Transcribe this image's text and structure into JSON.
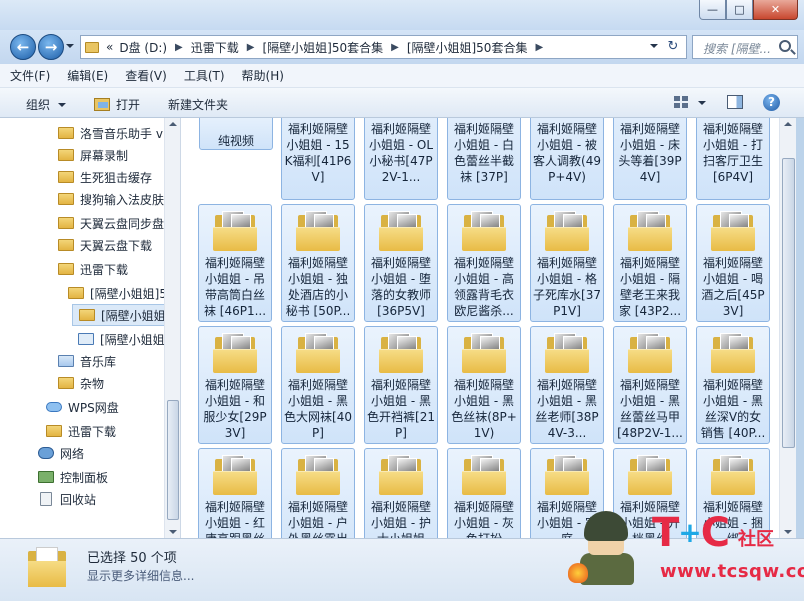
{
  "window": {
    "minimize": "—",
    "maximize": "□",
    "close": "✕"
  },
  "nav": {
    "back": "←",
    "forward": "→"
  },
  "address": {
    "prefix": "«",
    "crumbs": [
      "D盘 (D:)",
      "迅雷下载",
      "[隔壁小姐姐]50套合集",
      "[隔壁小姐姐]50套合集"
    ],
    "refresh": "↻"
  },
  "search": {
    "placeholder": "搜索 [隔壁..."
  },
  "menu": [
    "文件(F)",
    "编辑(E)",
    "查看(V)",
    "工具(T)",
    "帮助(H)"
  ],
  "toolbar": {
    "organize": "组织",
    "open": "打开",
    "new_folder": "新建文件夹",
    "help": "?"
  },
  "sidebar": {
    "items": [
      {
        "label": "洛雪音乐助手 v",
        "icon": "folder-icon"
      },
      {
        "label": "屏幕录制",
        "icon": "folder-icon"
      },
      {
        "label": "生死狙击缓存",
        "icon": "folder-icon"
      },
      {
        "label": "搜狗输入法皮肤",
        "icon": "folder-icon"
      },
      {
        "label": "天翼云盘同步盘",
        "icon": "folder-icon"
      },
      {
        "label": "天翼云盘下载",
        "icon": "folder-icon"
      },
      {
        "label": "迅雷下载",
        "icon": "folder-icon"
      },
      {
        "label": "[隔壁小姐姐]5",
        "icon": "folder-icon"
      },
      {
        "label": "[隔壁小姐姐",
        "icon": "folder-icon"
      },
      {
        "label": "[隔壁小姐姐]",
        "icon": "zip-icon"
      },
      {
        "label": "音乐库",
        "icon": "music-library-icon"
      },
      {
        "label": "杂物",
        "icon": "folder-icon"
      },
      {
        "label": "WPS网盘",
        "icon": "cloud-icon"
      },
      {
        "label": "迅雷下载",
        "icon": "folder-icon"
      },
      {
        "label": "网络",
        "icon": "network-icon"
      },
      {
        "label": "控制面板",
        "icon": "control-panel-icon"
      },
      {
        "label": "回收站",
        "icon": "recycle-bin-icon"
      }
    ]
  },
  "folders": {
    "row0": [
      {
        "label": "纯视频"
      },
      {
        "label": "福利姬隔壁小姐姐 - 15K福利[41P6V]"
      },
      {
        "label": "福利姬隔壁小姐姐 - OL小秘书[47P2V-1..."
      },
      {
        "label": "福利姬隔壁小姐姐 - 白色蕾丝半截袜 [37P]"
      },
      {
        "label": "福利姬隔壁小姐姐 - 被客人调教(49P+4V)"
      },
      {
        "label": "福利姬隔壁小姐姐 - 床头等着[39P4V]"
      },
      {
        "label": "福利姬隔壁小姐姐 - 打扫客厅卫生[6P4V]"
      }
    ],
    "row1": [
      {
        "label": "福利姬隔壁小姐姐 - 吊带高筒白丝袜 [46P1..."
      },
      {
        "label": "福利姬隔壁小姐姐 - 独处酒店的小秘书 [50P..."
      },
      {
        "label": "福利姬隔壁小姐姐 - 堕落的女教师[36P5V]"
      },
      {
        "label": "福利姬隔壁小姐姐 - 高领露背毛衣欧尼酱杀..."
      },
      {
        "label": "福利姬隔壁小姐姐 - 格子死库水[37P1V]"
      },
      {
        "label": "福利姬隔壁小姐姐 - 隔壁老王来我家 [43P2..."
      },
      {
        "label": "福利姬隔壁小姐姐 - 喝酒之后[45P3V]"
      }
    ],
    "row2": [
      {
        "label": "福利姬隔壁小姐姐 - 和服少女[29P3V]"
      },
      {
        "label": "福利姬隔壁小姐姐 - 黑色大网袜[40P]"
      },
      {
        "label": "福利姬隔壁小姐姐 - 黑色开裆裤[21P]"
      },
      {
        "label": "福利姬隔壁小姐姐 - 黑色丝袜(8P+1V)"
      },
      {
        "label": "福利姬隔壁小姐姐 - 黑丝老师[38P4V-3..."
      },
      {
        "label": "福利姬隔壁小姐姐 - 黑丝蕾丝马甲[48P2V-1..."
      },
      {
        "label": "福利姬隔壁小姐姐 - 黑丝深V的女销售 [40P..."
      }
    ],
    "row3": [
      {
        "label": "福利姬隔壁小姐姐 - 红唐高跟黑丝"
      },
      {
        "label": "福利姬隔壁小姐姐 - 户外黑丝露出"
      },
      {
        "label": "福利姬隔壁小姐姐 - 护士小姐姐"
      },
      {
        "label": "福利姬隔壁小姐姐 - 灰色打扮"
      },
      {
        "label": "福利姬隔壁小姐姐 - 家庭"
      },
      {
        "label": "福利姬隔壁小姐姐 - 开档黑丝"
      },
      {
        "label": "福利姬隔壁小姐姐 - 捆绑"
      }
    ]
  },
  "details": {
    "selected": "已选择 50 个项",
    "more": "显示更多详细信息..."
  },
  "watermark": {
    "logo_t": "T",
    "logo_c": "C",
    "plus": "+",
    "sub": "社区",
    "url": "www.tcsqw.com"
  }
}
